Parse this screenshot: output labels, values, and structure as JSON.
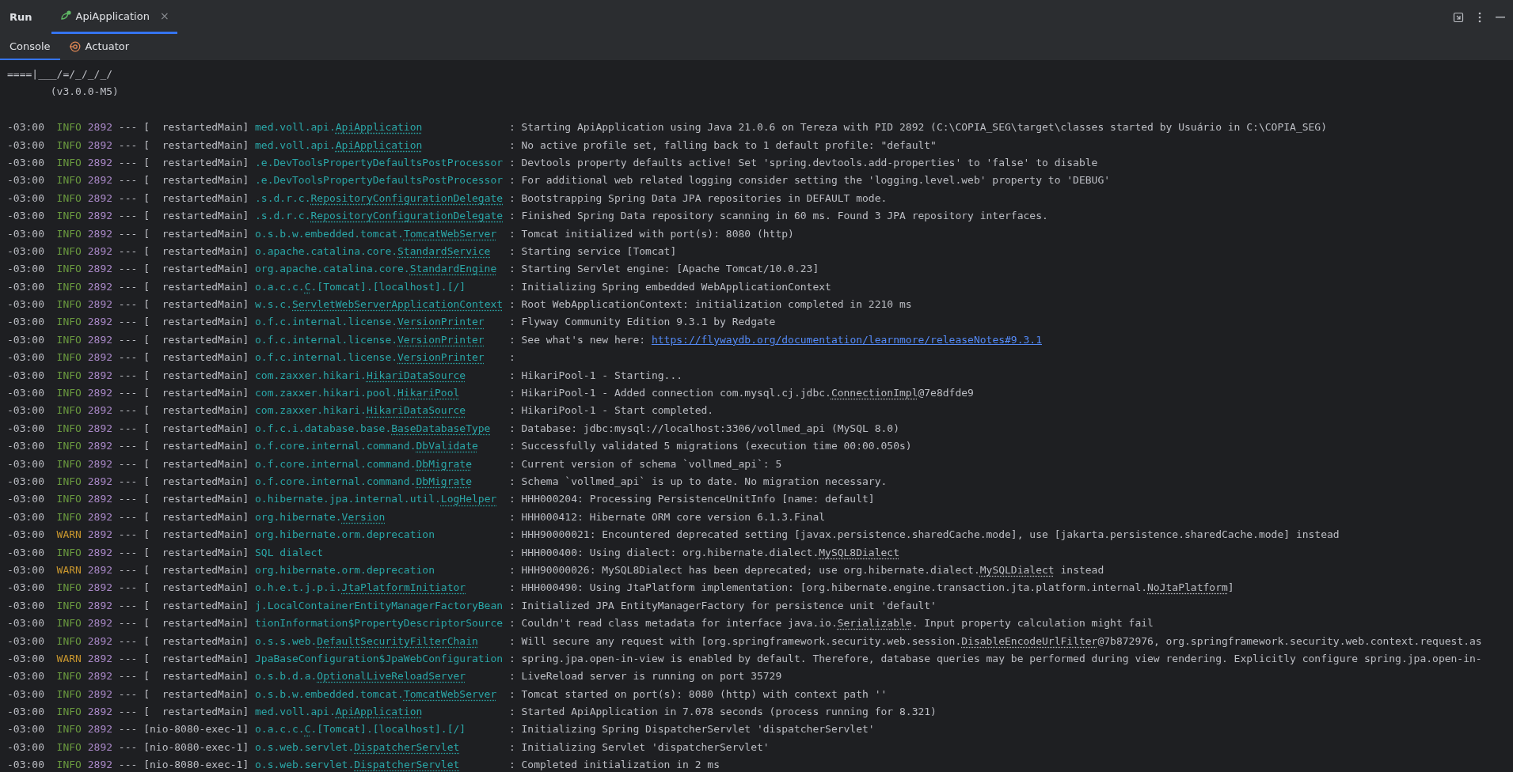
{
  "toolbar": {
    "title": "Run",
    "tabs": [
      {
        "label": "ApiApplication",
        "selected": true,
        "close": "×"
      }
    ]
  },
  "subtabs": [
    {
      "label": "Console",
      "selected": true,
      "kind": "console"
    },
    {
      "label": "Actuator",
      "selected": false,
      "kind": "actuator"
    }
  ],
  "banner": [
    "====|___/=/_/_/_/",
    "       (v3.0.0-M5)"
  ],
  "log": [
    {
      "time": "-03:00",
      "level": "INFO",
      "color": "#6a9a3f",
      "pid": "2892",
      "sep": "---",
      "thread": "[  restartedMain]",
      "logger": {
        "package": "med.voll.api.",
        "class": "ApiApplication"
      },
      "colon": ":",
      "message": [
        {
          "kind": "plain",
          "text": "Starting ApiApplication using Java 21.0.6 on Tereza with PID 2892 (C:\\COPIA_SEG\\target\\classes started by Usuário in C:\\COPIA_SEG)"
        }
      ]
    },
    {
      "time": "-03:00",
      "level": "INFO",
      "color": "#6a9a3f",
      "pid": "2892",
      "sep": "---",
      "thread": "[  restartedMain]",
      "logger": {
        "package": "med.voll.api.",
        "class": "ApiApplication"
      },
      "colon": ":",
      "message": [
        {
          "kind": "plain",
          "text": "No active profile set, falling back to 1 default profile: \"default\""
        }
      ]
    },
    {
      "time": "-03:00",
      "level": "INFO",
      "color": "#6a9a3f",
      "pid": "2892",
      "sep": "---",
      "thread": "[  restartedMain]",
      "logger": {
        "package": ".e.DevToolsPropertyDefaultsPostProcessor"
      },
      "colon": ":",
      "message": [
        {
          "kind": "plain",
          "text": "Devtools property defaults active! Set 'spring.devtools.add-properties' to 'false' to disable"
        }
      ]
    },
    {
      "time": "-03:00",
      "level": "INFO",
      "color": "#6a9a3f",
      "pid": "2892",
      "sep": "---",
      "thread": "[  restartedMain]",
      "logger": {
        "package": ".e.DevToolsPropertyDefaultsPostProcessor"
      },
      "colon": ":",
      "message": [
        {
          "kind": "plain",
          "text": "For additional web related logging consider setting the 'logging.level.web' property to 'DEBUG'"
        }
      ]
    },
    {
      "time": "-03:00",
      "level": "INFO",
      "color": "#6a9a3f",
      "pid": "2892",
      "sep": "---",
      "thread": "[  restartedMain]",
      "logger": {
        "package": ".s.d.r.c.",
        "class": "RepositoryConfigurationDelegate"
      },
      "colon": ":",
      "message": [
        {
          "kind": "plain",
          "text": "Bootstrapping Spring Data JPA repositories in DEFAULT mode."
        }
      ]
    },
    {
      "time": "-03:00",
      "level": "INFO",
      "color": "#6a9a3f",
      "pid": "2892",
      "sep": "---",
      "thread": "[  restartedMain]",
      "logger": {
        "package": ".s.d.r.c.",
        "class": "RepositoryConfigurationDelegate"
      },
      "colon": ":",
      "message": [
        {
          "kind": "plain",
          "text": "Finished Spring Data repository scanning in 60 ms. Found 3 JPA repository interfaces."
        }
      ]
    },
    {
      "time": "-03:00",
      "level": "INFO",
      "color": "#6a9a3f",
      "pid": "2892",
      "sep": "---",
      "thread": "[  restartedMain]",
      "logger": {
        "package": "o.s.b.w.embedded.tomcat.",
        "class": "TomcatWebServer"
      },
      "colon": ":",
      "message": [
        {
          "kind": "plain",
          "text": "Tomcat initialized with port(s): 8080 (http)"
        }
      ]
    },
    {
      "time": "-03:00",
      "level": "INFO",
      "color": "#6a9a3f",
      "pid": "2892",
      "sep": "---",
      "thread": "[  restartedMain]",
      "logger": {
        "package": "o.apache.catalina.core.",
        "class": "StandardService"
      },
      "colon": ":",
      "message": [
        {
          "kind": "plain",
          "text": "Starting service [Tomcat]"
        }
      ]
    },
    {
      "time": "-03:00",
      "level": "INFO",
      "color": "#6a9a3f",
      "pid": "2892",
      "sep": "---",
      "thread": "[  restartedMain]",
      "logger": {
        "package": "org.apache.catalina.core.",
        "class": "StandardEngine"
      },
      "colon": ":",
      "message": [
        {
          "kind": "plain",
          "text": "Starting Servlet engine: [Apache Tomcat/10.0.23]"
        }
      ]
    },
    {
      "time": "-03:00",
      "level": "INFO",
      "color": "#6a9a3f",
      "pid": "2892",
      "sep": "---",
      "thread": "[  restartedMain]",
      "logger": {
        "package": "o.a.c.c.",
        "class": "C",
        "rest": ".[Tomcat].[localhost].[/]"
      },
      "colon": ":",
      "message": [
        {
          "kind": "plain",
          "text": "Initializing Spring embedded WebApplicationContext"
        }
      ]
    },
    {
      "time": "-03:00",
      "level": "INFO",
      "color": "#6a9a3f",
      "pid": "2892",
      "sep": "---",
      "thread": "[  restartedMain]",
      "logger": {
        "package": "w.s.c.",
        "class": "ServletWebServerApplicationContext"
      },
      "colon": ":",
      "message": [
        {
          "kind": "plain",
          "text": "Root WebApplicationContext: initialization completed in 2210 ms"
        }
      ]
    },
    {
      "time": "-03:00",
      "level": "INFO",
      "color": "#6a9a3f",
      "pid": "2892",
      "sep": "---",
      "thread": "[  restartedMain]",
      "logger": {
        "package": "o.f.c.internal.license.",
        "class": "VersionPrinter"
      },
      "colon": ":",
      "message": [
        {
          "kind": "plain",
          "text": "Flyway Community Edition 9.3.1 by Redgate"
        }
      ]
    },
    {
      "time": "-03:00",
      "level": "INFO",
      "color": "#6a9a3f",
      "pid": "2892",
      "sep": "---",
      "thread": "[  restartedMain]",
      "logger": {
        "package": "o.f.c.internal.license.",
        "class": "VersionPrinter"
      },
      "colon": ":",
      "message": [
        {
          "kind": "plain",
          "text": "See what's new here: "
        },
        {
          "kind": "url",
          "text": "https://flywaydb.org/documentation/learnmore/releaseNotes#9.3.1"
        }
      ]
    },
    {
      "time": "-03:00",
      "level": "INFO",
      "color": "#6a9a3f",
      "pid": "2892",
      "sep": "---",
      "thread": "[  restartedMain]",
      "logger": {
        "package": "o.f.c.internal.license.",
        "class": "VersionPrinter"
      },
      "colon": ":"
    },
    {
      "time": "-03:00",
      "level": "INFO",
      "color": "#6a9a3f",
      "pid": "2892",
      "sep": "---",
      "thread": "[  restartedMain]",
      "logger": {
        "package": "com.zaxxer.hikari.",
        "class": "HikariDataSource"
      },
      "colon": ":",
      "message": [
        {
          "kind": "plain",
          "text": "HikariPool-1 - Starting..."
        }
      ]
    },
    {
      "time": "-03:00",
      "level": "INFO",
      "color": "#6a9a3f",
      "pid": "2892",
      "sep": "---",
      "thread": "[  restartedMain]",
      "logger": {
        "package": "com.zaxxer.hikari.pool.",
        "class": "HikariPool"
      },
      "colon": ":",
      "message": [
        {
          "kind": "plain",
          "text": "HikariPool-1 - Added connection com.mysql.cj.jdbc."
        },
        {
          "kind": "class",
          "text": "ConnectionImpl"
        },
        {
          "kind": "plain",
          "text": "@7e8dfde9"
        }
      ]
    },
    {
      "time": "-03:00",
      "level": "INFO",
      "color": "#6a9a3f",
      "pid": "2892",
      "sep": "---",
      "thread": "[  restartedMain]",
      "logger": {
        "package": "com.zaxxer.hikari.",
        "class": "HikariDataSource"
      },
      "colon": ":",
      "message": [
        {
          "kind": "plain",
          "text": "HikariPool-1 - Start completed."
        }
      ]
    },
    {
      "time": "-03:00",
      "level": "INFO",
      "color": "#6a9a3f",
      "pid": "2892",
      "sep": "---",
      "thread": "[  restartedMain]",
      "logger": {
        "package": "o.f.c.i.database.base.",
        "class": "BaseDatabaseType"
      },
      "colon": ":",
      "message": [
        {
          "kind": "plain",
          "text": "Database: jdbc:mysql://localhost:3306/vollmed_api (MySQL 8.0)"
        }
      ]
    },
    {
      "time": "-03:00",
      "level": "INFO",
      "color": "#6a9a3f",
      "pid": "2892",
      "sep": "---",
      "thread": "[  restartedMain]",
      "logger": {
        "package": "o.f.core.internal.command.",
        "class": "DbValidate"
      },
      "colon": ":",
      "message": [
        {
          "kind": "plain",
          "text": "Successfully validated 5 migrations (execution time 00:00.050s)"
        }
      ]
    },
    {
      "time": "-03:00",
      "level": "INFO",
      "color": "#6a9a3f",
      "pid": "2892",
      "sep": "---",
      "thread": "[  restartedMain]",
      "logger": {
        "package": "o.f.core.internal.command.",
        "class": "DbMigrate"
      },
      "colon": ":",
      "message": [
        {
          "kind": "plain",
          "text": "Current version of schema `vollmed_api`: 5"
        }
      ]
    },
    {
      "time": "-03:00",
      "level": "INFO",
      "color": "#6a9a3f",
      "pid": "2892",
      "sep": "---",
      "thread": "[  restartedMain]",
      "logger": {
        "package": "o.f.core.internal.command.",
        "class": "DbMigrate"
      },
      "colon": ":",
      "message": [
        {
          "kind": "plain",
          "text": "Schema `vollmed_api` is up to date. No migration necessary."
        }
      ]
    },
    {
      "time": "-03:00",
      "level": "INFO",
      "color": "#6a9a3f",
      "pid": "2892",
      "sep": "---",
      "thread": "[  restartedMain]",
      "logger": {
        "package": "o.hibernate.jpa.internal.util.",
        "class": "LogHelper"
      },
      "colon": ":",
      "message": [
        {
          "kind": "plain",
          "text": "HHH000204: Processing PersistenceUnitInfo [name: default]"
        }
      ]
    },
    {
      "time": "-03:00",
      "level": "INFO",
      "color": "#6a9a3f",
      "pid": "2892",
      "sep": "---",
      "thread": "[  restartedMain]",
      "logger": {
        "package": "org.hibernate.",
        "class": "Version"
      },
      "colon": ":",
      "message": [
        {
          "kind": "plain",
          "text": "HHH000412: Hibernate ORM core version 6.1.3.Final"
        }
      ]
    },
    {
      "time": "-03:00",
      "level": "WARN",
      "color": "#c8962e",
      "pid": "2892",
      "sep": "---",
      "thread": "[  restartedMain]",
      "logger": {
        "package": "org.hibernate.orm.deprecation"
      },
      "colon": ":",
      "message": [
        {
          "kind": "plain",
          "text": "HHH90000021: Encountered deprecated setting [javax.persistence.sharedCache.mode], use [jakarta.persistence.sharedCache.mode] instead"
        }
      ]
    },
    {
      "time": "-03:00",
      "level": "INFO",
      "color": "#6a9a3f",
      "pid": "2892",
      "sep": "---",
      "thread": "[  restartedMain]",
      "logger": {
        "package": "SQL dialect"
      },
      "colon": ":",
      "message": [
        {
          "kind": "plain",
          "text": "HHH000400: Using dialect: org.hibernate.dialect."
        },
        {
          "kind": "class",
          "text": "MySQL8Dialect"
        }
      ]
    },
    {
      "time": "-03:00",
      "level": "WARN",
      "color": "#c8962e",
      "pid": "2892",
      "sep": "---",
      "thread": "[  restartedMain]",
      "logger": {
        "package": "org.hibernate.orm.deprecation"
      },
      "colon": ":",
      "message": [
        {
          "kind": "plain",
          "text": "HHH90000026: MySQL8Dialect has been deprecated; use org.hibernate.dialect."
        },
        {
          "kind": "class",
          "text": "MySQLDialect"
        },
        {
          "kind": "plain",
          "text": " instead"
        }
      ]
    },
    {
      "time": "-03:00",
      "level": "INFO",
      "color": "#6a9a3f",
      "pid": "2892",
      "sep": "---",
      "thread": "[  restartedMain]",
      "logger": {
        "package": "o.h.e.t.j.p.i.",
        "class": "JtaPlatformInitiator"
      },
      "colon": ":",
      "message": [
        {
          "kind": "plain",
          "text": "HHH000490: Using JtaPlatform implementation: [org.hibernate.engine.transaction.jta.platform.internal."
        },
        {
          "kind": "class",
          "text": "NoJtaPlatform"
        },
        {
          "kind": "plain",
          "text": "]"
        }
      ]
    },
    {
      "time": "-03:00",
      "level": "INFO",
      "color": "#6a9a3f",
      "pid": "2892",
      "sep": "---",
      "thread": "[  restartedMain]",
      "logger": {
        "package": "j.LocalContainerEntityManagerFactoryBean"
      },
      "colon": ":",
      "message": [
        {
          "kind": "plain",
          "text": "Initialized JPA EntityManagerFactory for persistence unit 'default'"
        }
      ]
    },
    {
      "time": "-03:00",
      "level": "INFO",
      "color": "#6a9a3f",
      "pid": "2892",
      "sep": "---",
      "thread": "[  restartedMain]",
      "logger": {
        "package": "tionInformation$PropertyDescriptorSource"
      },
      "colon": ":",
      "message": [
        {
          "kind": "plain",
          "text": "Couldn't read class metadata for interface java.io."
        },
        {
          "kind": "class",
          "text": "Serializable"
        },
        {
          "kind": "plain",
          "text": ". Input property calculation might fail"
        }
      ]
    },
    {
      "time": "-03:00",
      "level": "INFO",
      "color": "#6a9a3f",
      "pid": "2892",
      "sep": "---",
      "thread": "[  restartedMain]",
      "logger": {
        "package": "o.s.s.web.",
        "class": "DefaultSecurityFilterChain"
      },
      "colon": ":",
      "message": [
        {
          "kind": "plain",
          "text": "Will secure any request with [org.springframework.security.web.session."
        },
        {
          "kind": "class",
          "text": "DisableEncodeUrlFilter"
        },
        {
          "kind": "plain",
          "text": "@7b872976, org.springframework.security.web.context.request.as"
        }
      ]
    },
    {
      "time": "-03:00",
      "level": "WARN",
      "color": "#c8962e",
      "pid": "2892",
      "sep": "---",
      "thread": "[  restartedMain]",
      "logger": {
        "package": "JpaBaseConfiguration$JpaWebConfiguration"
      },
      "colon": ":",
      "message": [
        {
          "kind": "plain",
          "text": "spring.jpa.open-in-view is enabled by default. Therefore, database queries may be performed during view rendering. Explicitly configure spring.jpa.open-in-"
        }
      ]
    },
    {
      "time": "-03:00",
      "level": "INFO",
      "color": "#6a9a3f",
      "pid": "2892",
      "sep": "---",
      "thread": "[  restartedMain]",
      "logger": {
        "package": "o.s.b.d.a.",
        "class": "OptionalLiveReloadServer"
      },
      "colon": ":",
      "message": [
        {
          "kind": "plain",
          "text": "LiveReload server is running on port 35729"
        }
      ]
    },
    {
      "time": "-03:00",
      "level": "INFO",
      "color": "#6a9a3f",
      "pid": "2892",
      "sep": "---",
      "thread": "[  restartedMain]",
      "logger": {
        "package": "o.s.b.w.embedded.tomcat.",
        "class": "TomcatWebServer"
      },
      "colon": ":",
      "message": [
        {
          "kind": "plain",
          "text": "Tomcat started on port(s): 8080 (http) with context path ''"
        }
      ]
    },
    {
      "time": "-03:00",
      "level": "INFO",
      "color": "#6a9a3f",
      "pid": "2892",
      "sep": "---",
      "thread": "[  restartedMain]",
      "logger": {
        "package": "med.voll.api.",
        "class": "ApiApplication"
      },
      "colon": ":",
      "message": [
        {
          "kind": "plain",
          "text": "Started ApiApplication in 7.078 seconds (process running for 8.321)"
        }
      ]
    },
    {
      "time": "-03:00",
      "level": "INFO",
      "color": "#6a9a3f",
      "pid": "2892",
      "sep": "---",
      "thread": "[nio-8080-exec-1]",
      "logger": {
        "package": "o.a.c.c.",
        "class": "C",
        "rest": ".[Tomcat].[localhost].[/]"
      },
      "colon": ":",
      "message": [
        {
          "kind": "plain",
          "text": "Initializing Spring DispatcherServlet 'dispatcherServlet'"
        }
      ]
    },
    {
      "time": "-03:00",
      "level": "INFO",
      "color": "#6a9a3f",
      "pid": "2892",
      "sep": "---",
      "thread": "[nio-8080-exec-1]",
      "logger": {
        "package": "o.s.web.servlet.",
        "class": "DispatcherServlet"
      },
      "colon": ":",
      "message": [
        {
          "kind": "plain",
          "text": "Initializing Servlet 'dispatcherServlet'"
        }
      ]
    },
    {
      "time": "-03:00",
      "level": "INFO",
      "color": "#6a9a3f",
      "pid": "2892",
      "sep": "---",
      "thread": "[nio-8080-exec-1]",
      "logger": {
        "package": "o.s.web.servlet.",
        "class": "DispatcherServlet"
      },
      "colon": ":",
      "message": [
        {
          "kind": "plain",
          "text": "Completed initialization in 2 ms"
        }
      ]
    }
  ]
}
